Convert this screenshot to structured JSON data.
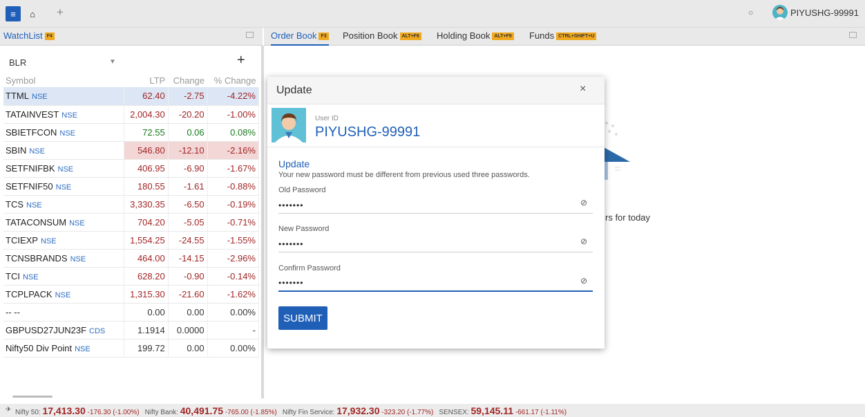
{
  "topbar": {
    "user_name": "PIYUSHG-99991",
    "add_tab": "+"
  },
  "watchlist": {
    "tab_label": "WatchList",
    "tab_kbd": "F4",
    "group_name": "BLR",
    "add_label": "+",
    "columns": [
      "Symbol",
      "LTP",
      "Change",
      "% Change"
    ],
    "rows": [
      {
        "symbol": "TTML",
        "exch": "NSE",
        "ltp": "62.40",
        "change": "-2.75",
        "pct": "-4.22%",
        "dir": "neg"
      },
      {
        "symbol": "TATAINVEST",
        "exch": "NSE",
        "ltp": "2,004.30",
        "change": "-20.20",
        "pct": "-1.00%",
        "dir": "neg"
      },
      {
        "symbol": "SBIETFCON",
        "exch": "NSE",
        "ltp": "72.55",
        "change": "0.06",
        "pct": "0.08%",
        "dir": "pos"
      },
      {
        "symbol": "SBIN",
        "exch": "NSE",
        "ltp": "546.80",
        "change": "-12.10",
        "pct": "-2.16%",
        "dir": "neg"
      },
      {
        "symbol": "SETFNIFBK",
        "exch": "NSE",
        "ltp": "406.95",
        "change": "-6.90",
        "pct": "-1.67%",
        "dir": "neg"
      },
      {
        "symbol": "SETFNIF50",
        "exch": "NSE",
        "ltp": "180.55",
        "change": "-1.61",
        "pct": "-0.88%",
        "dir": "neg"
      },
      {
        "symbol": "TCS",
        "exch": "NSE",
        "ltp": "3,330.35",
        "change": "-6.50",
        "pct": "-0.19%",
        "dir": "neg"
      },
      {
        "symbol": "TATACONSUM",
        "exch": "NSE",
        "ltp": "704.20",
        "change": "-5.05",
        "pct": "-0.71%",
        "dir": "neg"
      },
      {
        "symbol": "TCIEXP",
        "exch": "NSE",
        "ltp": "1,554.25",
        "change": "-24.55",
        "pct": "-1.55%",
        "dir": "neg"
      },
      {
        "symbol": "TCNSBRANDS",
        "exch": "NSE",
        "ltp": "464.00",
        "change": "-14.15",
        "pct": "-2.96%",
        "dir": "neg"
      },
      {
        "symbol": "TCI",
        "exch": "NSE",
        "ltp": "628.20",
        "change": "-0.90",
        "pct": "-0.14%",
        "dir": "neg"
      },
      {
        "symbol": "TCPLPACK",
        "exch": "NSE",
        "ltp": "1,315.30",
        "change": "-21.60",
        "pct": "-1.62%",
        "dir": "neg"
      },
      {
        "symbol": "-- --",
        "exch": "",
        "ltp": "0.00",
        "change": "0.00",
        "pct": "0.00%",
        "dir": "neu"
      },
      {
        "symbol": "GBPUSD27JUN23F",
        "exch": "CDS",
        "ltp": "1.1914",
        "change": "0.0000",
        "pct": "-",
        "dir": "neu"
      },
      {
        "symbol": "Nifty50 Div Point",
        "exch": "NSE",
        "ltp": "199.72",
        "change": "0.00",
        "pct": "0.00%",
        "dir": "neu"
      }
    ]
  },
  "right_tabs": [
    {
      "label": "Order Book",
      "kbd": "F3"
    },
    {
      "label": "Position Book",
      "kbd": "ALT+F6"
    },
    {
      "label": "Holding Book",
      "kbd": "ALT+F9"
    },
    {
      "label": "Funds",
      "kbd": "CTRL+SHIFT+U"
    }
  ],
  "background_text": "rs for today",
  "dialog": {
    "title": "Update",
    "close": "×",
    "user_id_label": "User ID",
    "user_id": "PIYUSHG-99991",
    "section_title": "Update",
    "description": "Your new password must be different from previous used three passwords.",
    "old_label": "Old Password",
    "old_value": "•••••••",
    "new_label": "New Password",
    "new_value": "•••••••",
    "confirm_label": "Confirm Password",
    "confirm_value": "•••••••",
    "submit": "SUBMIT"
  },
  "ticker": [
    {
      "name": "Nifty 50:",
      "value": "17,413.30",
      "change": "-176.30 (-1.00%)"
    },
    {
      "name": "Nifty Bank:",
      "value": "40,491.75",
      "change": "-765.00 (-1.85%)"
    },
    {
      "name": "Nifty Fin Service:",
      "value": "17,932.30",
      "change": "-323.20 (-1.77%)"
    },
    {
      "name": "SENSEX:",
      "value": "59,145.11",
      "change": "-661.17 (-1.11%)"
    }
  ],
  "colors": {
    "accent": "#1f5fb8",
    "negative": "#a12424",
    "positive": "#177a1a",
    "kbd": "#f0a91e"
  }
}
